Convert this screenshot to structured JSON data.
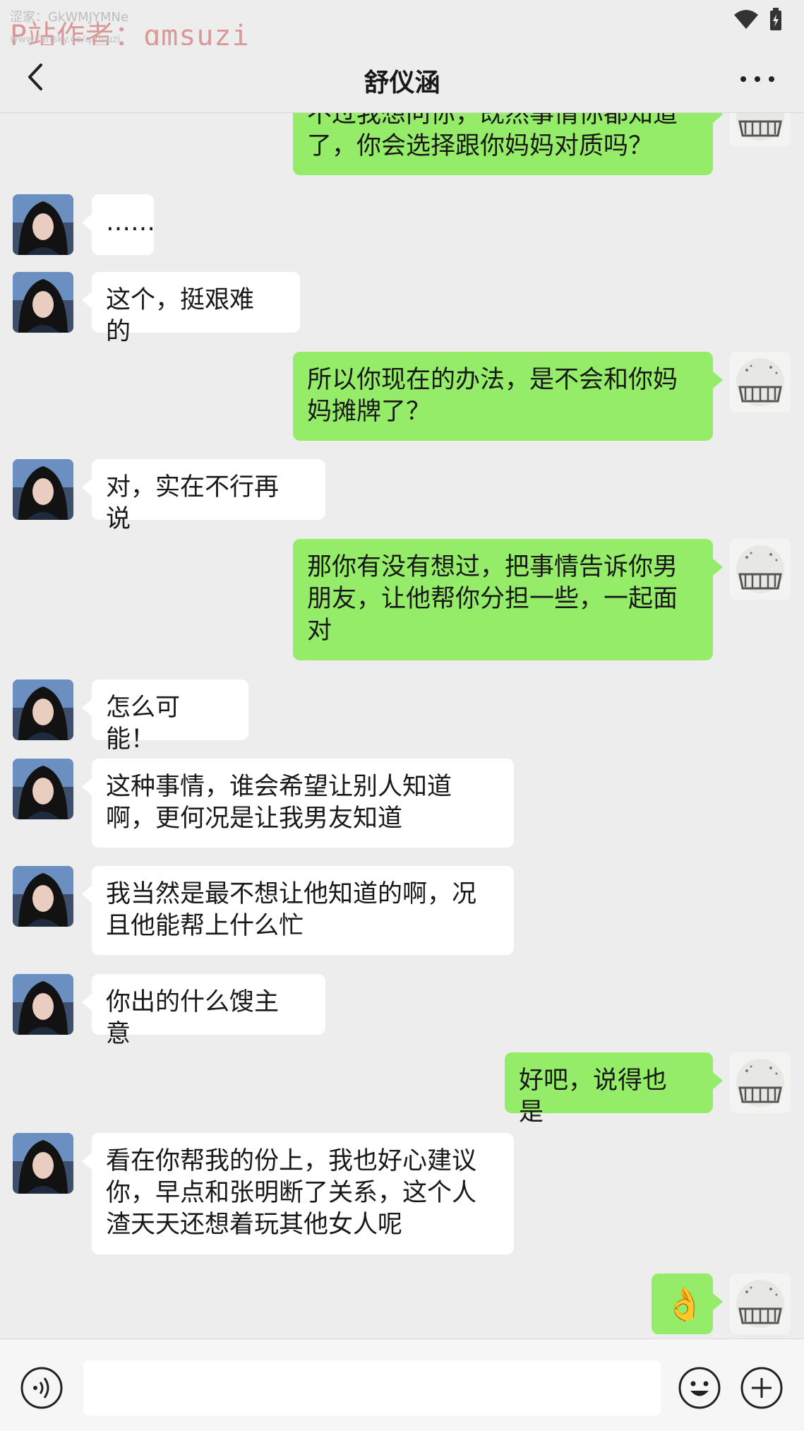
{
  "status_bar": {
    "watermark_small": "涩家：GkWMJYMNe",
    "watermark_main": "P站作者：qmsuzi",
    "watermark_url": "www.fansky.co/qmsuzi",
    "icons": [
      "wifi-icon",
      "battery-charging-icon"
    ]
  },
  "nav": {
    "title": "舒仪涵",
    "back_icon": "chevron-left-icon",
    "more_icon": "more-dots-icon"
  },
  "messages": [
    {
      "side": "right",
      "text": "不过我想问你，既然事情你都知道\n了，你会选择跟你妈妈对质吗？"
    },
    {
      "side": "left",
      "text": "……"
    },
    {
      "side": "left",
      "text": "这个，挺艰难的"
    },
    {
      "side": "right",
      "text": "所以你现在的办法，是不会和你妈\n妈摊牌了？"
    },
    {
      "side": "left",
      "text": "对，实在不行再说"
    },
    {
      "side": "right",
      "text": "那你有没有想过，把事情告诉你男\n朋友，让他帮你分担一些，一起面\n对"
    },
    {
      "side": "left",
      "text": "怎么可能！"
    },
    {
      "side": "left",
      "text": "这种事情，谁会希望让别人知道\n啊，更何况是让我男友知道"
    },
    {
      "side": "left",
      "text": "我当然是最不想让他知道的啊，况\n且他能帮上什么忙"
    },
    {
      "side": "left",
      "text": "你出的什么馊主意"
    },
    {
      "side": "right",
      "text": "好吧，说得也是"
    },
    {
      "side": "left",
      "text": "看在你帮我的份上，我也好心建议\n你，早点和张明断了关系，这个人\n渣天天还想着玩其他女人呢"
    },
    {
      "side": "right",
      "emoji": "ok-hand-emoji",
      "text": "👌"
    }
  ],
  "input_bar": {
    "voice_icon": "voice-icon",
    "emoji_icon": "smiley-icon",
    "plus_icon": "plus-icon",
    "input_value": ""
  },
  "colors": {
    "background": "#ededed",
    "sent_bubble": "#95ec69",
    "received_bubble": "#ffffff"
  }
}
